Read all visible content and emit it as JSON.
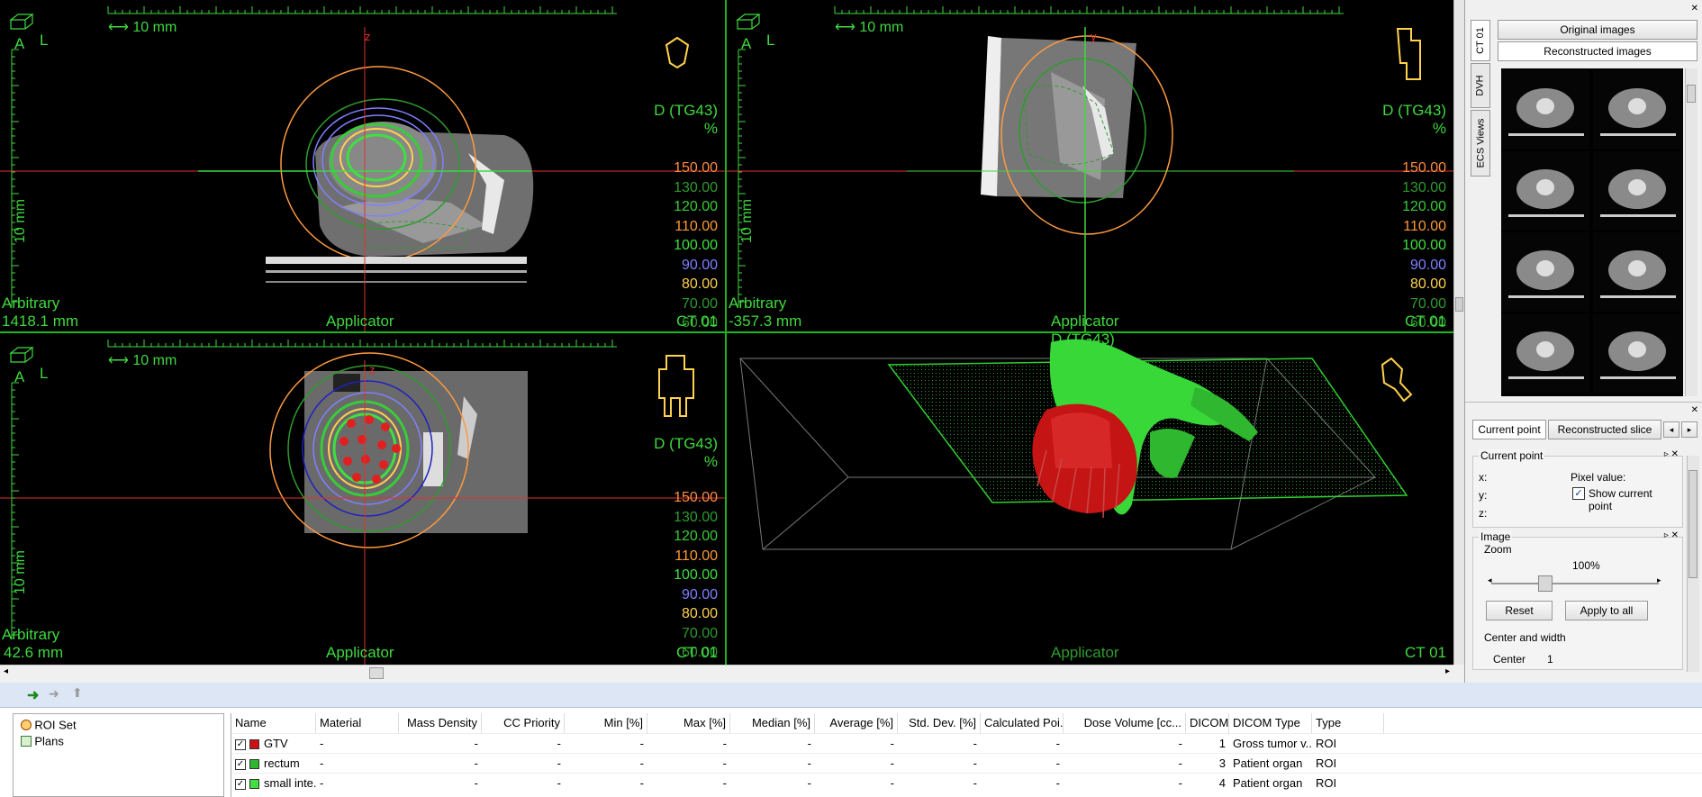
{
  "colors": {
    "overlay_green": "#3fd93f",
    "crosshair": "#e53030",
    "ruler": "#3fd93f",
    "legend": [
      "#ff8c40",
      "#2e9b2e",
      "#39cc39",
      "#ff9933",
      "#3fe03f",
      "#8080ff",
      "#ffd24d",
      "#2e9b2e",
      "#2e9b2e"
    ]
  },
  "viewports": [
    {
      "orient_a": "A",
      "orient_l": "L",
      "scale": "10 mm",
      "vscale": "10 mm",
      "axis_label": "z",
      "dose_title": "D (TG43)",
      "dose_unit": "%",
      "legend": [
        "150.00",
        "130.00",
        "120.00",
        "110.00",
        "100.00",
        "90.00",
        "80.00",
        "70.00",
        "60.00"
      ],
      "bl_line1": "Arbitrary",
      "bl_line2": "1418.1 mm",
      "bottom_center": "Applicator",
      "bottom_right": "CT 01",
      "icon": "head-orientation-icon"
    },
    {
      "orient_a": "A",
      "orient_l": "L",
      "scale": "10 mm",
      "vscale": "10 mm",
      "axis_label": "y",
      "dose_title": "D (TG43)",
      "dose_unit": "%",
      "legend": [
        "150.00",
        "130.00",
        "120.00",
        "110.00",
        "100.00",
        "90.00",
        "80.00",
        "70.00",
        "60.00"
      ],
      "bl_line1": "Arbitrary",
      "bl_line2": "-357.3 mm",
      "bottom_center": "Applicator",
      "bottom_right": "CT 01",
      "icon": "sagittal-orientation-icon"
    },
    {
      "orient_a": "A",
      "orient_l": "L",
      "scale": "10 mm",
      "vscale": "10 mm",
      "axis_label": "z",
      "dose_title": "D (TG43)",
      "dose_unit": "%",
      "legend": [
        "150.00",
        "130.00",
        "120.00",
        "110.00",
        "100.00",
        "90.00",
        "80.00",
        "70.00",
        "60.00"
      ],
      "bl_line1": "Arbitrary",
      "bl_line2": "42.6 mm",
      "bottom_center": "Applicator",
      "bottom_right": "CT 01",
      "icon": "body-orientation-icon"
    },
    {
      "dose_title": "D (TG43)",
      "bottom_center": "Applicator",
      "bottom_right": "CT 01",
      "icon": "3d-orientation-icon"
    }
  ],
  "right_panel": {
    "tabs": [
      "CT 01",
      "DVH",
      "ECS Views"
    ],
    "original_images": "Original images",
    "reconstructed_images": "Reconstructed images",
    "bottom_tabs": [
      "Current point",
      "Reconstructed slice"
    ],
    "current_point": {
      "title": "Current point",
      "x": "x:",
      "y": "y:",
      "z": "z:",
      "pixel_value": "Pixel value:",
      "show_current_point": "Show current point"
    },
    "image": {
      "title": "Image",
      "zoom": "Zoom",
      "zoom_value": "100%",
      "reset": "Reset",
      "apply_to_all": "Apply to all",
      "center_and_width": "Center and width",
      "center": "Center",
      "center_value": "1"
    }
  },
  "bottom": {
    "tree": [
      {
        "label": "ROI Set",
        "icon": "roi-set-icon"
      },
      {
        "label": "Plans",
        "icon": "plans-icon"
      }
    ],
    "columns": [
      "Name",
      "Material",
      "Mass Density",
      "CC Priority",
      "Min [%]",
      "Max [%]",
      "Median [%]",
      "Average [%]",
      "Std. Dev. [%]",
      "Calculated Poi...",
      "Dose Volume [cc...",
      "DICOM #",
      "DICOM Type",
      "Type"
    ],
    "rows": [
      {
        "name": "GTV",
        "color": "#d01010",
        "material": "-",
        "mass_density": "-",
        "cc_priority": "-",
        "min": "-",
        "max": "-",
        "median": "-",
        "average": "-",
        "std": "-",
        "calc": "-",
        "dose_volume": "-",
        "dicom": "1",
        "dicom_type": "Gross tumor v...",
        "type": "ROI"
      },
      {
        "name": "rectum",
        "color": "#2fb82f",
        "material": "-",
        "mass_density": "-",
        "cc_priority": "-",
        "min": "-",
        "max": "-",
        "median": "-",
        "average": "-",
        "std": "-",
        "calc": "-",
        "dose_volume": "-",
        "dicom": "3",
        "dicom_type": "Patient organ",
        "type": "ROI"
      },
      {
        "name": "small inte...",
        "color": "#3fe03f",
        "material": "-",
        "mass_density": "-",
        "cc_priority": "-",
        "min": "-",
        "max": "-",
        "median": "-",
        "average": "-",
        "std": "-",
        "calc": "-",
        "dose_volume": "-",
        "dicom": "4",
        "dicom_type": "Patient organ",
        "type": "ROI"
      }
    ]
  }
}
